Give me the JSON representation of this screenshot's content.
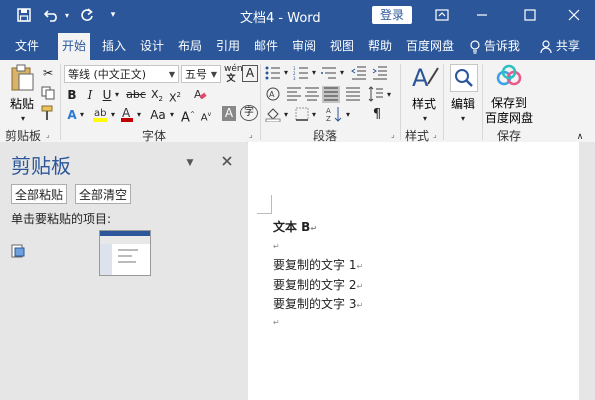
{
  "window": {
    "title": "文档4 - Word",
    "login_label": "登录",
    "icons": [
      "save-icon",
      "undo-icon",
      "redo-icon",
      "customize-qat-icon",
      "ribbon-display-icon",
      "minimize-icon",
      "maximize-icon",
      "close-icon"
    ]
  },
  "tabs": [
    {
      "label": "文件"
    },
    {
      "label": "开始"
    },
    {
      "label": "插入"
    },
    {
      "label": "设计"
    },
    {
      "label": "布局"
    },
    {
      "label": "引用"
    },
    {
      "label": "邮件"
    },
    {
      "label": "审阅"
    },
    {
      "label": "视图"
    },
    {
      "label": "帮助"
    },
    {
      "label": "百度网盘"
    }
  ],
  "active_tab": "开始",
  "tell_me": "告诉我",
  "share": "共享",
  "ribbon": {
    "clipboard": {
      "paste_label": "粘贴",
      "group_label": "剪贴板"
    },
    "font": {
      "font_name": "等线 (中文正文)",
      "font_size": "五号",
      "group_label": "字体",
      "aa_label": "Aa"
    },
    "paragraph": {
      "group_label": "段落"
    },
    "styles": {
      "styles_label": "样式",
      "group_label": "样式"
    },
    "editing": {
      "label": "编辑"
    },
    "save": {
      "label_line1": "保存到",
      "label_line2": "百度网盘",
      "group_label": "保存"
    }
  },
  "clipboard_pane": {
    "title": "剪贴板",
    "paste_all": "全部粘贴",
    "clear_all": "全部清空",
    "hint": "单击要粘贴的项目:"
  },
  "document": {
    "lines": [
      "文本 B",
      "",
      "要复制的文字 1",
      "要复制的文字 2",
      "要复制的文字 3",
      ""
    ],
    "paragraph_mark": "↵"
  },
  "colors": {
    "accent": "#2b579a",
    "ribbon_bg": "#f3f3f3",
    "pane_bg": "#e6e6e6",
    "highlight": "#ffff00",
    "font_color": "#c00000"
  }
}
